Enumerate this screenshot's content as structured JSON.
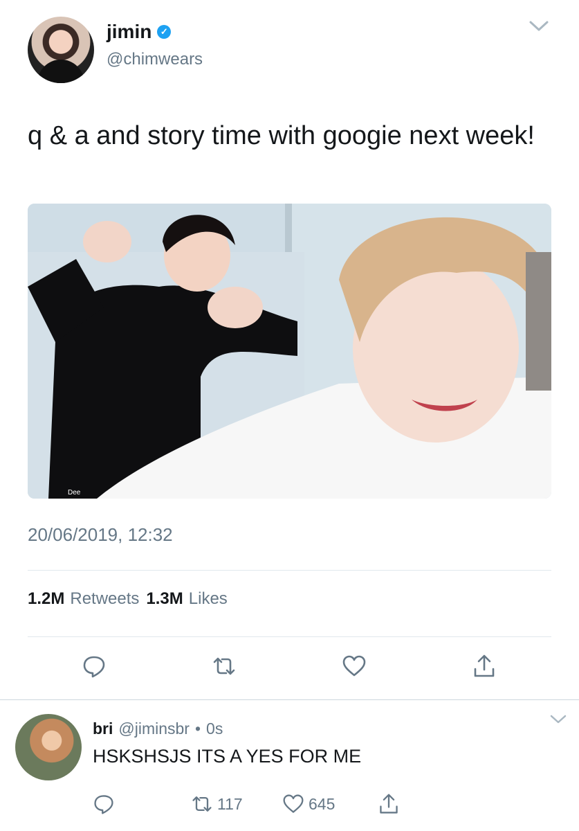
{
  "tweet": {
    "display_name": "jimin",
    "handle": "@chimwears",
    "text": "q & a and story time with googie next week!",
    "timestamp": "20/06/2019, 12:32",
    "retweets_count": "1.2M",
    "retweets_label": "Retweets",
    "likes_count": "1.3M",
    "likes_label": "Likes",
    "media_watermark": "Dee"
  },
  "reply": {
    "display_name": "bri",
    "handle": "@jiminsbr",
    "separator": "•",
    "time": "0s",
    "text": "HSKSHSJS ITS A YES FOR ME",
    "retweet_count": "117",
    "like_count": "645"
  },
  "colors": {
    "text_primary": "#14171a",
    "text_secondary": "#657786",
    "verified_blue": "#1da1f2",
    "divider": "#e1e8ed"
  },
  "icons": [
    "chevron-down-icon",
    "verified-badge-icon",
    "reply-icon",
    "retweet-icon",
    "like-icon",
    "share-icon"
  ]
}
